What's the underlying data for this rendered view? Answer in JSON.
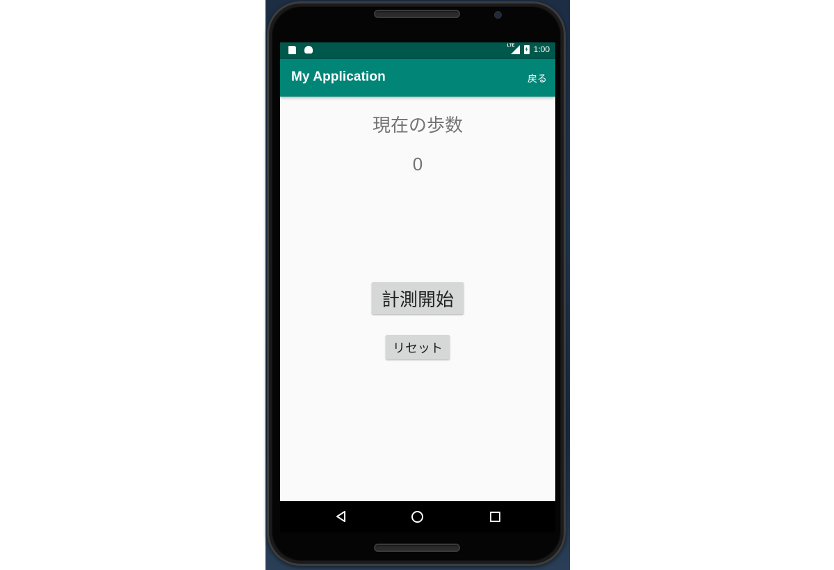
{
  "status_bar": {
    "time": "1:00",
    "network_label": "LTE",
    "left_icons": [
      "sd-card-icon",
      "android-icon"
    ],
    "right_icons": [
      "lte-signal-icon",
      "battery-charging-icon"
    ]
  },
  "app_bar": {
    "title": "My Application",
    "back_menu_label": "戻る"
  },
  "main": {
    "steps_label": "現在の歩数",
    "steps_value": "0",
    "start_button_label": "計測開始",
    "reset_button_label": "リセット"
  },
  "nav_bar": {
    "icons": [
      "back-icon",
      "home-icon",
      "recents-icon"
    ]
  },
  "colors": {
    "status_bar": "#00574b",
    "app_bar": "#008577",
    "content_background": "#fafafa",
    "button_background": "#d6d7d7",
    "text_secondary": "#737373"
  }
}
